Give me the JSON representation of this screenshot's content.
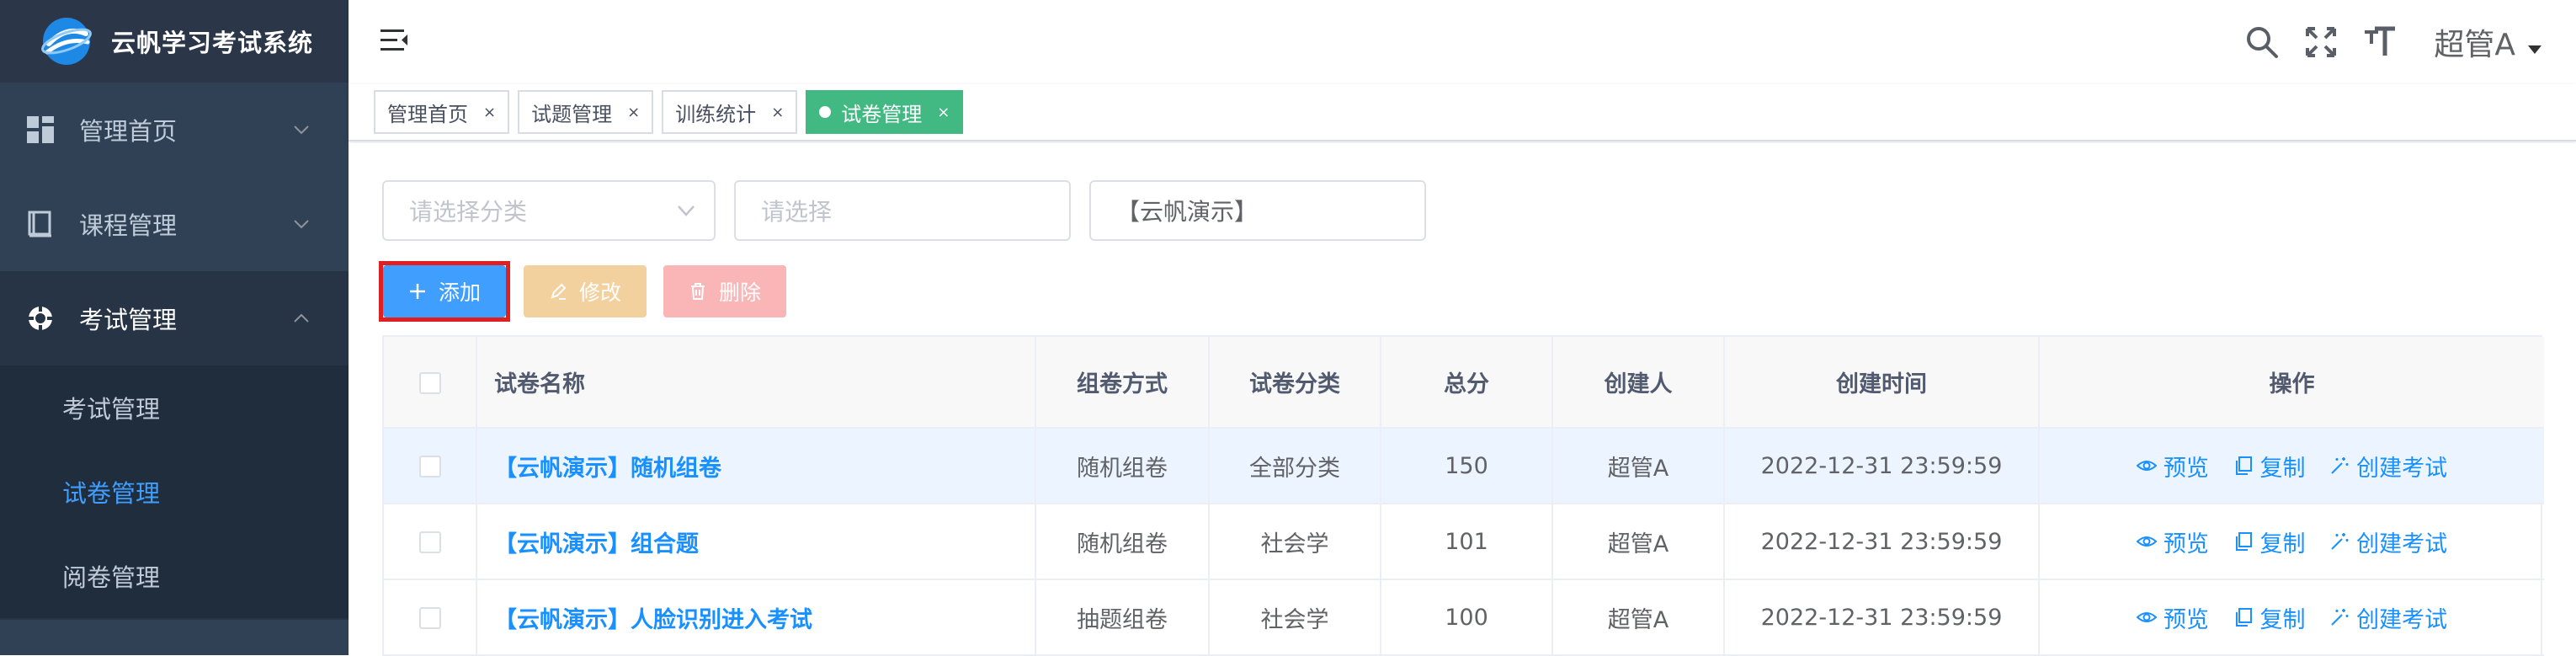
{
  "app": {
    "title": "云帆学习考试系统"
  },
  "sidebar": {
    "menus": [
      {
        "label": "管理首页",
        "icon": "dashboard-icon",
        "open": false
      },
      {
        "label": "课程管理",
        "icon": "book-icon",
        "open": false
      },
      {
        "label": "考试管理",
        "icon": "exam-icon",
        "open": true
      }
    ],
    "sub_items": [
      {
        "label": "考试管理",
        "active": false
      },
      {
        "label": "试卷管理",
        "active": true
      },
      {
        "label": "阅卷管理",
        "active": false
      }
    ]
  },
  "header": {
    "user": "超管A",
    "icons": [
      "search-icon",
      "fullscreen-icon",
      "font-size-icon"
    ]
  },
  "tags": [
    {
      "label": "管理首页",
      "active": false,
      "close": "×"
    },
    {
      "label": "试题管理",
      "active": false,
      "close": "×"
    },
    {
      "label": "训练统计",
      "active": false,
      "close": "×"
    },
    {
      "label": "试卷管理",
      "active": true,
      "close": "×"
    }
  ],
  "filters": {
    "category_placeholder": "请选择分类",
    "select_placeholder": "请选择",
    "keyword_value": "【云帆演示】"
  },
  "toolbar": {
    "add": "添加",
    "edit": "修改",
    "delete": "删除"
  },
  "table": {
    "columns": [
      "试卷名称",
      "组卷方式",
      "试卷分类",
      "总分",
      "创建人",
      "创建时间",
      "操作"
    ],
    "rows": [
      {
        "name": "【云帆演示】随机组卷",
        "method": "随机组卷",
        "category": "全部分类",
        "score": "150",
        "creator": "超管A",
        "time": "2022-12-31 23:59:59"
      },
      {
        "name": "【云帆演示】组合题",
        "method": "随机组卷",
        "category": "社会学",
        "score": "101",
        "creator": "超管A",
        "time": "2022-12-31 23:59:59"
      },
      {
        "name": "【云帆演示】人脸识别进入考试",
        "method": "抽题组卷",
        "category": "社会学",
        "score": "100",
        "creator": "超管A",
        "time": "2022-12-31 23:59:59"
      }
    ],
    "ops": {
      "preview": "预览",
      "copy": "复制",
      "create_exam": "创建考试"
    }
  },
  "colors": {
    "sidebar_bg": "#304156",
    "active_menu": "#409eff",
    "active_tag": "#42b983",
    "link": "#1890ff",
    "highlight_border": "#e02020"
  }
}
